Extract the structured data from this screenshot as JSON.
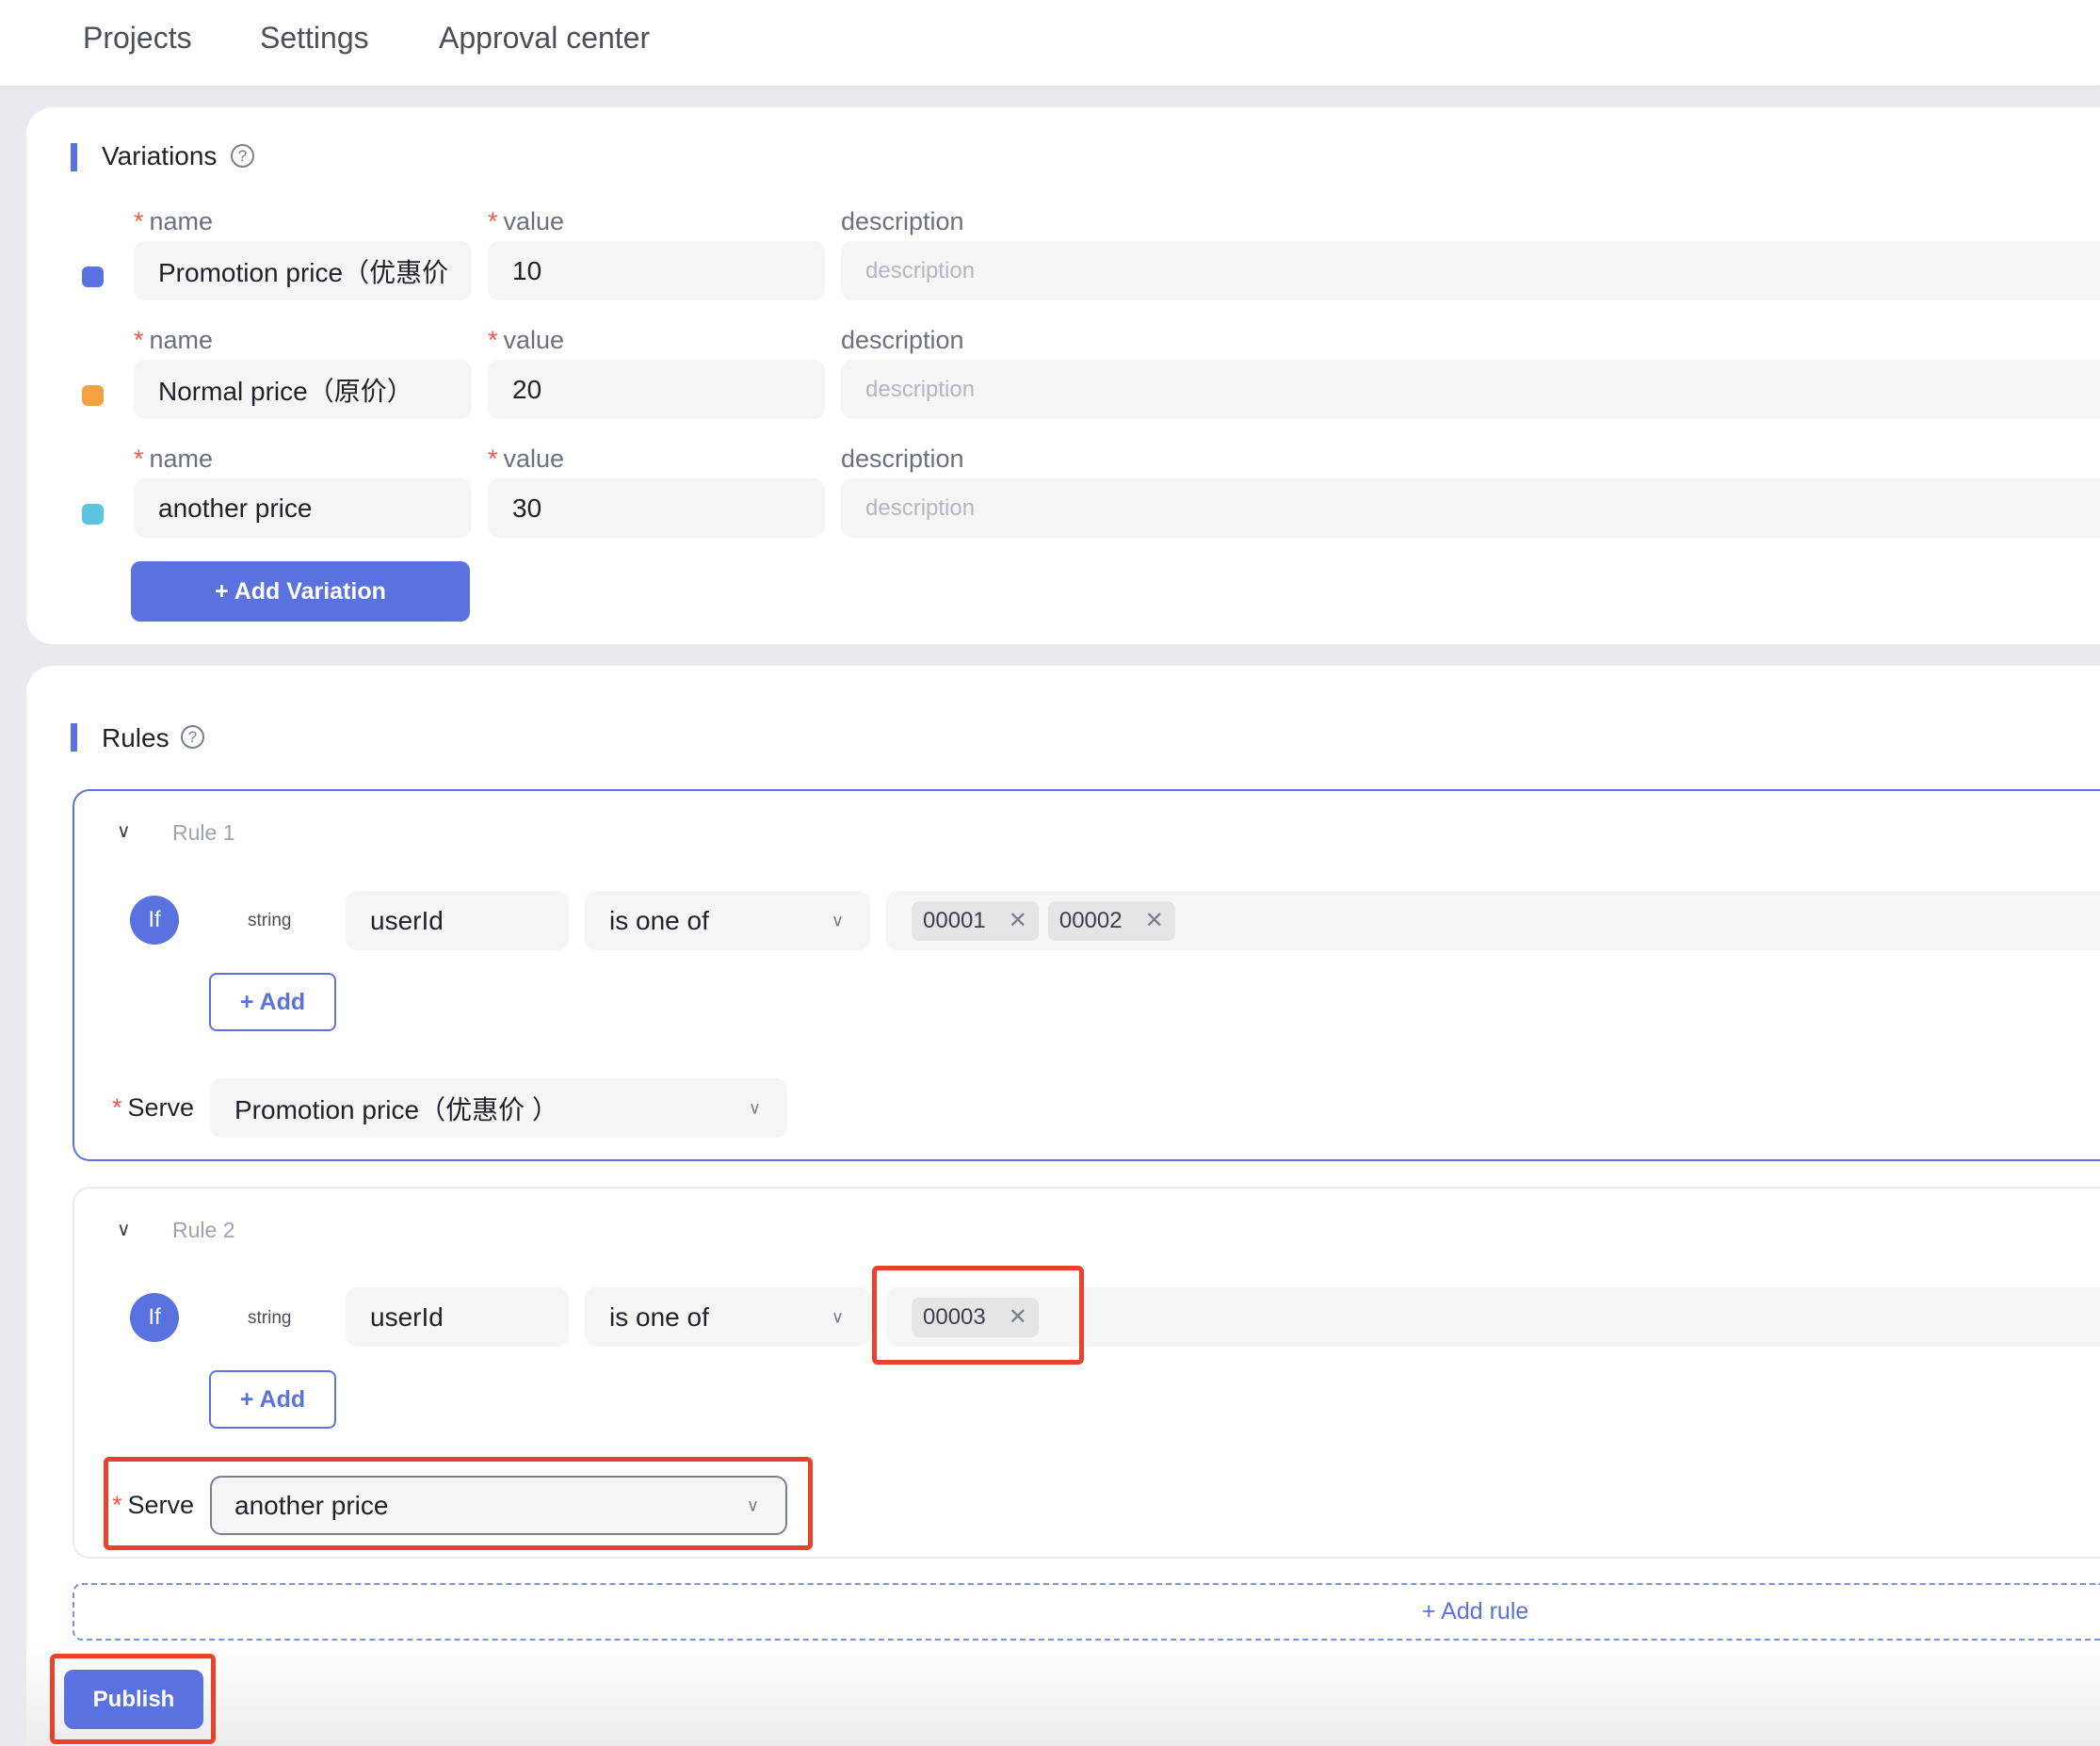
{
  "nav": {
    "items": [
      "Projects",
      "Settings",
      "Approval center"
    ]
  },
  "variations": {
    "title": "Variations",
    "help_icon": "question-circle-icon",
    "labels": {
      "name": "name",
      "value": "value",
      "description": "description"
    },
    "rows": [
      {
        "color": "#5a72e0",
        "name": "Promotion price（优惠价",
        "value": "10",
        "description_placeholder": "description"
      },
      {
        "color": "#f4a142",
        "name": "Normal price（原价）",
        "value": "20",
        "description_placeholder": "description"
      },
      {
        "color": "#5bc4e0",
        "name": "another price",
        "value": "30",
        "description_placeholder": "description"
      }
    ],
    "add_button": "+ Add Variation"
  },
  "rules": {
    "title": "Rules",
    "help_icon": "question-circle-icon",
    "items": [
      {
        "title": "Rule 1",
        "if_label": "If",
        "type": "string",
        "attribute": "userId",
        "operator": "is one of",
        "values": [
          "00001",
          "00002"
        ],
        "add_label": "+ Add",
        "serve_label": "Serve",
        "serve_value": "Promotion price（优惠价 ）"
      },
      {
        "title": "Rule 2",
        "if_label": "If",
        "type": "string",
        "attribute": "userId",
        "operator": "is one of",
        "values": [
          "00003"
        ],
        "add_label": "+ Add",
        "serve_label": "Serve",
        "serve_value": "another price"
      }
    ],
    "add_rule": "+ Add rule"
  },
  "footer": {
    "publish": "Publish"
  },
  "colors": {
    "accent": "#5a72e0",
    "required": "#f05a4a",
    "highlight": "#e8412e"
  }
}
